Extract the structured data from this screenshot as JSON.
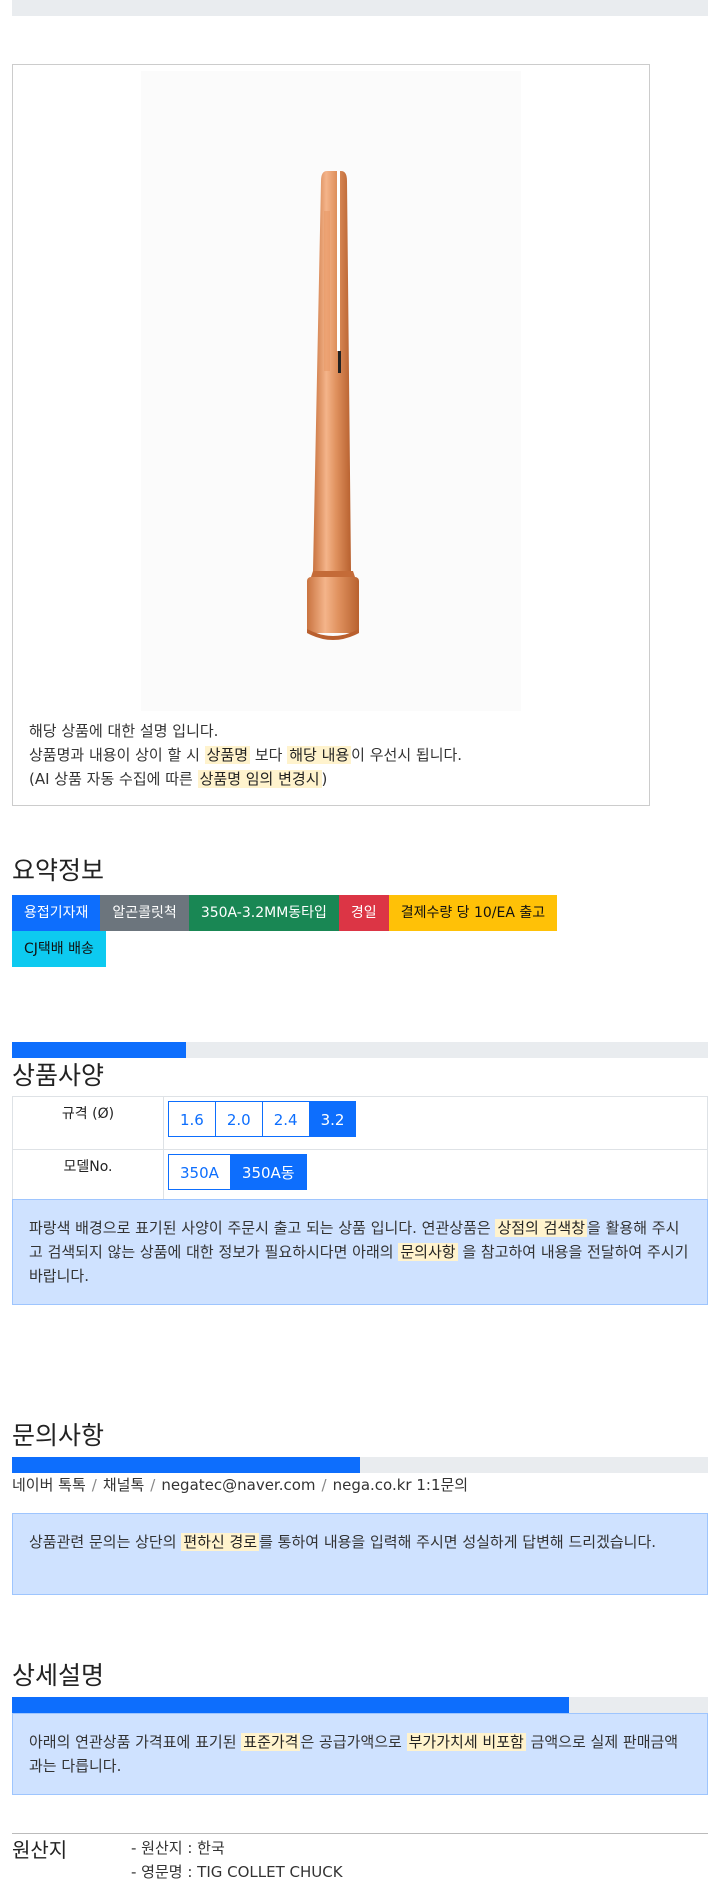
{
  "description": {
    "line1": "해당 상품에 대한 설명 입니다.",
    "line2_a": "상품명과 내용이 상이 할 시 ",
    "line2_mark1": "상품명",
    "line2_b": " 보다 ",
    "line2_mark2": "해당 내용",
    "line2_c": "이 우선시 됩니다.",
    "line3_a": "(AI 상품 자동 수집에 따른 ",
    "line3_mark": "상품명 임의 변경시",
    "line3_b": ")"
  },
  "summary": {
    "title": "요약정보",
    "badges": [
      {
        "label": "용접기자재",
        "color": "#0d6efd"
      },
      {
        "label": "알곤콜릿척",
        "color": "#6c757d"
      },
      {
        "label": "350A-3.2MM동타입",
        "color": "#198754"
      },
      {
        "label": "경일",
        "color": "#dc3545"
      },
      {
        "label": "결제수량 당 10/EA 출고",
        "color": "#ffc107"
      },
      {
        "label": "CJ택배 배송",
        "color": "#0dcaf0"
      }
    ]
  },
  "spec": {
    "title": "상품사양",
    "progress": 0.25,
    "rows": [
      {
        "label": "규격 (Ø)",
        "options": [
          "1.6",
          "2.0",
          "2.4",
          "3.2"
        ],
        "selected": "3.2"
      },
      {
        "label": "모델No.",
        "options": [
          "350A",
          "350A동"
        ],
        "selected": "350A동"
      }
    ],
    "notice_a": "파랑색 배경으로 표기된 사양이 주문시 출고 되는 상품 입니다. 연관상품은 ",
    "notice_mark1": "상점의 검색창",
    "notice_b": "을 활용해 주시고 검색되지 않는 상품에 대한 정보가 필요하시다면 아래의 ",
    "notice_mark2": "문의사항",
    "notice_c": " 을 참고하여 내용을 전달하여 주시기 바랍니다."
  },
  "inquiry": {
    "title": "문의사항",
    "progress": 0.5,
    "links": [
      "네이버 톡톡",
      "채널톡",
      "negatec@naver.com",
      "nega.co.kr 1:1문의"
    ],
    "notice_a": "상품관련 문의는 상단의 ",
    "notice_mark": "편하신 경로",
    "notice_b": "를 통하여 내용을 입력해 주시면 성실하게 답변해 드리겠습니다."
  },
  "detail": {
    "title": "상세설명",
    "progress": 0.8,
    "notice_a": "아래의 연관상품 가격표에 표기된 ",
    "notice_mark1": "표준가격",
    "notice_b": "은 공급가액으로 ",
    "notice_mark2": "부가가치세 비포함",
    "notice_c": " 금액으로 실제 판매금액과는 다릅니다."
  },
  "origin": {
    "label": "원산지",
    "line1": "- 원산지 : 한국",
    "line2": "- 영문명 : TIG COLLET CHUCK"
  }
}
